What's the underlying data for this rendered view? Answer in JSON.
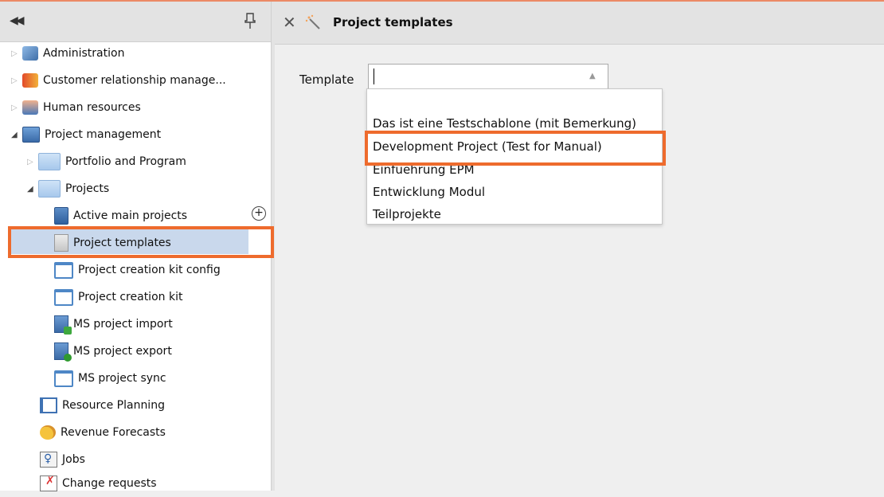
{
  "sidebar": {
    "items": [
      {
        "label": "Administration"
      },
      {
        "label": "Customer relationship manage..."
      },
      {
        "label": "Human resources"
      },
      {
        "label": "Project management"
      },
      {
        "label": "Portfolio and Program"
      },
      {
        "label": "Projects"
      },
      {
        "label": "Active main projects"
      },
      {
        "label": "Project templates"
      },
      {
        "label": "Project creation kit config"
      },
      {
        "label": "Project creation kit"
      },
      {
        "label": "MS project import"
      },
      {
        "label": "MS project export"
      },
      {
        "label": "MS project sync"
      },
      {
        "label": "Resource Planning"
      },
      {
        "label": "Revenue Forecasts"
      },
      {
        "label": "Jobs"
      },
      {
        "label": "Change requests"
      }
    ],
    "selected": "Project templates"
  },
  "main": {
    "title": "Project templates",
    "form": {
      "template_label": "Template",
      "template_value": ""
    },
    "dropdown_options": [
      "Das ist eine Testschablone (mit Bemerkung)",
      "Development Project (Test for Manual)",
      "Einfuehrung EPM",
      "Entwicklung Modul",
      "Teilprojekte"
    ],
    "highlighted_option": "Development Project (Test for Manual)"
  },
  "colors": {
    "highlight": "#ee6b2d",
    "selection": "#c9d8ec",
    "header": "#e3e3e3"
  }
}
